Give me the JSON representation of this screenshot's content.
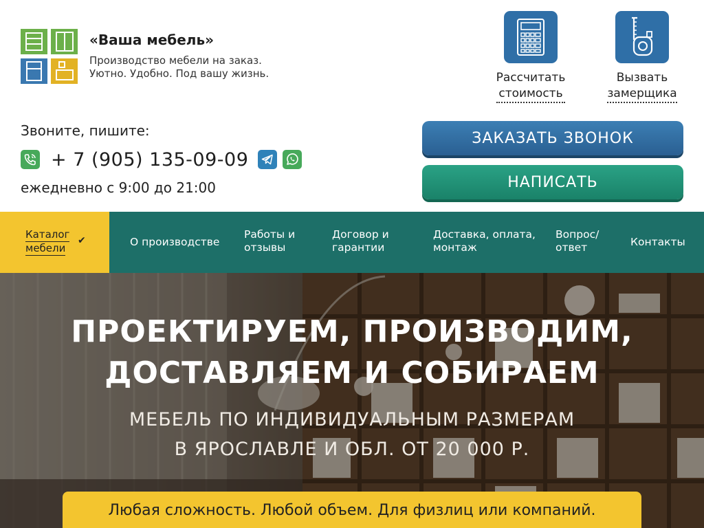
{
  "brand": {
    "name": "«Ваша мебель»",
    "tagline_line1": "Производство мебели на заказ.",
    "tagline_line2": "Уютно. Удобно. Под вашу жизнь."
  },
  "tools": [
    {
      "icon": "calculator-icon",
      "line1": "Рассчитать",
      "line2": "стоимость"
    },
    {
      "icon": "tape-measure-icon",
      "line1": "Вызвать",
      "line2": "замерщика"
    }
  ],
  "contact": {
    "caption": "Звоните, пишите:",
    "phone": "+ 7 (905) 135-09-09",
    "hours": "ежедневно с 9:00 до 21:00",
    "messengers": [
      "phone-icon",
      "telegram-icon",
      "whatsapp-icon"
    ]
  },
  "cta": {
    "call": "ЗАКАЗАТЬ ЗВОНОК",
    "write": "НАПИСАТЬ"
  },
  "nav": {
    "catalog_line1": "Каталог",
    "catalog_line2": "мебели",
    "catalog_check": "✔",
    "items": [
      {
        "line1": "О производстве",
        "line2": ""
      },
      {
        "line1": "Работы и",
        "line2": "отзывы"
      },
      {
        "line1": "Договор и",
        "line2": "гарантии"
      },
      {
        "line1": "Доставка, оплата,",
        "line2": "монтаж"
      },
      {
        "line1": "Вопрос/",
        "line2": "ответ"
      },
      {
        "line1": "Контакты",
        "line2": ""
      }
    ]
  },
  "hero": {
    "title_line1": "ПРОЕКТИРУЕМ, ПРОИЗВОДИМ,",
    "title_line2": "ДОСТАВЛЯЕМ И СОБИРАЕМ",
    "sub_line1": "МЕБЕЛЬ ПО ИНДИВИДУАЛЬНЫМ РАЗМЕРАМ",
    "sub_line2": "В ЯРОСЛАВЛЕ И ОБЛ. ОТ 20 000 Р.",
    "banner": "Любая сложность. Любой объем. Для физлиц или компаний."
  },
  "colors": {
    "nav_bg": "#1d6f68",
    "accent_yellow": "#f3c52f",
    "cta_blue": "#2f6fa7",
    "cta_green": "#1f8f74"
  }
}
